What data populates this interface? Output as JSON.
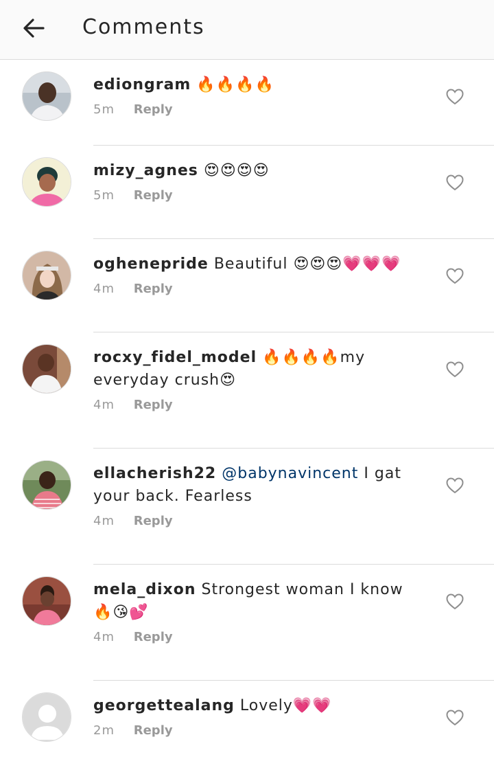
{
  "header": {
    "title": "Comments",
    "back_icon": "arrow-left-icon"
  },
  "comments": [
    {
      "username": "ediongram",
      "text": "",
      "emoji": "🔥🔥🔥🔥",
      "time": "5m",
      "reply": "Reply"
    },
    {
      "username": "mizy_agnes",
      "text": "",
      "emoji": "😍😍😍😍",
      "time": "5m",
      "reply": "Reply"
    },
    {
      "username": "oghenepride",
      "text": "Beautiful",
      "emoji": "😍😍😍💗💗💗",
      "time": "4m",
      "reply": "Reply"
    },
    {
      "username": "rocxy_fidel_model",
      "text": "🔥🔥🔥🔥my everyday crush😍",
      "time": "4m",
      "reply": "Reply"
    },
    {
      "username": "ellacherish22",
      "mention": "@babynavincent",
      "text": "I gat your back. Fearless",
      "time": "4m",
      "reply": "Reply"
    },
    {
      "username": "mela_dixon",
      "text": "Strongest woman I know🔥😘💕",
      "time": "4m",
      "reply": "Reply"
    },
    {
      "username": "georgettealang",
      "text": "Lovely💗💗",
      "time": "2m",
      "reply": "Reply"
    }
  ],
  "icons": {
    "like": "heart-outline-icon",
    "avatar_placeholder": "user-silhouette-icon"
  },
  "colors": {
    "mention": "#003569",
    "meta": "#999999",
    "divider": "#dbdbdb"
  }
}
